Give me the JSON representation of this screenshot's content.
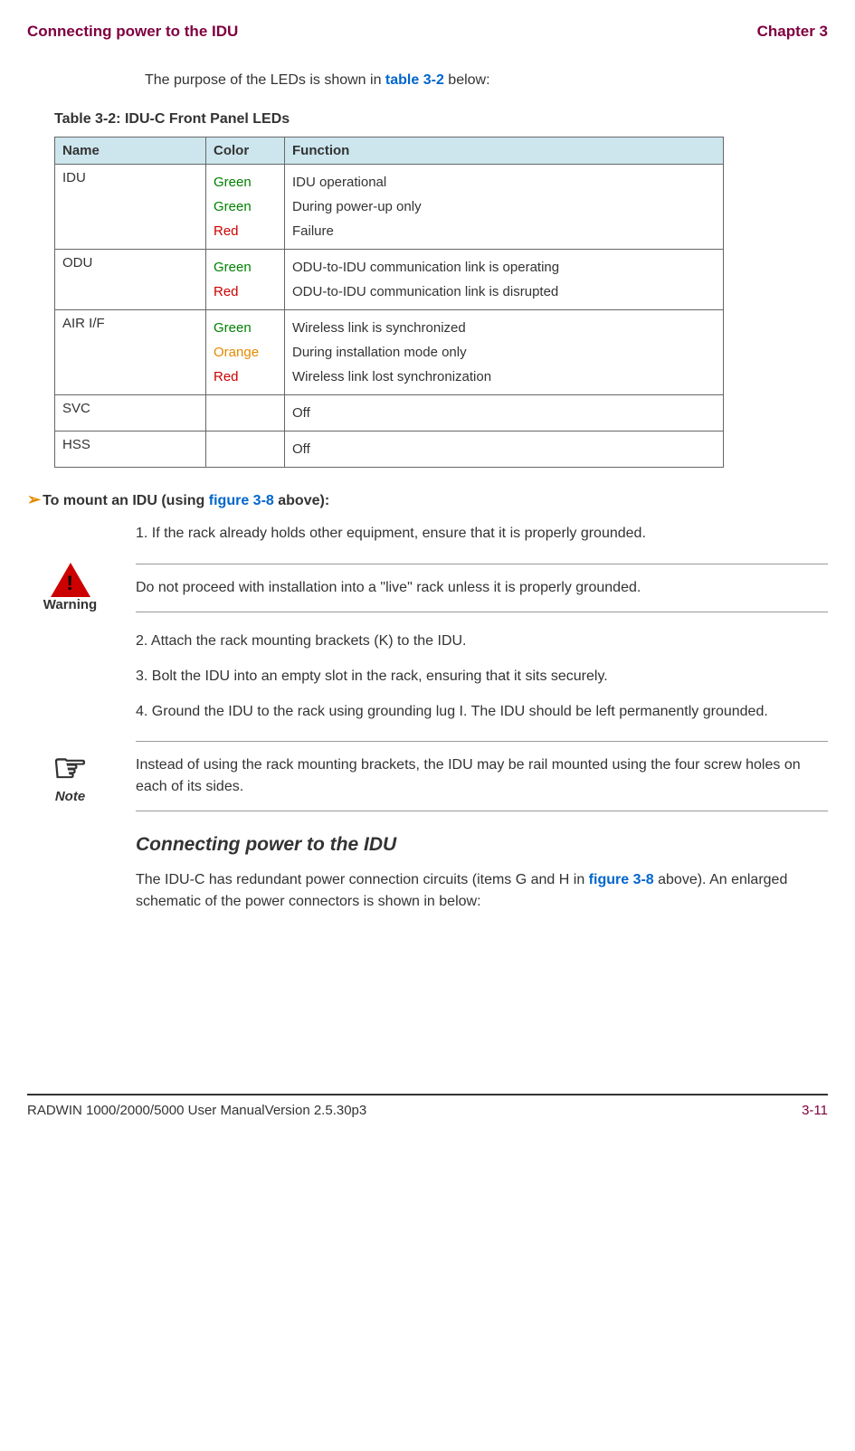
{
  "header": {
    "left": "Connecting power to the IDU",
    "right": "Chapter 3"
  },
  "intro": {
    "prefix": "The purpose of the LEDs is shown in ",
    "link": "table 3-2",
    "suffix": " below:"
  },
  "table": {
    "caption": "Table 3-2: IDU-C Front Panel LEDs",
    "headers": {
      "name": "Name",
      "color": "Color",
      "function": "Function"
    },
    "rows": [
      {
        "name": "IDU",
        "colors": [
          "Green",
          "Green",
          "Red"
        ],
        "colorClasses": [
          "green",
          "green",
          "red"
        ],
        "functions": [
          "IDU operational",
          "During power-up only",
          "Failure"
        ]
      },
      {
        "name": "ODU",
        "colors": [
          "Green",
          "Red"
        ],
        "colorClasses": [
          "green",
          "red"
        ],
        "functions": [
          "ODU-to-IDU communication link is operating",
          "ODU-to-IDU communication link is disrupted"
        ]
      },
      {
        "name": "AIR I/F",
        "colors": [
          "Green",
          "Orange",
          "Red"
        ],
        "colorClasses": [
          "green",
          "orange",
          "red"
        ],
        "functions": [
          "Wireless link is synchronized",
          "During installation mode only",
          "Wireless link lost synchronization"
        ]
      },
      {
        "name": "SVC",
        "colors": [
          ""
        ],
        "colorClasses": [
          ""
        ],
        "functions": [
          "Off"
        ]
      },
      {
        "name": "HSS",
        "colors": [
          ""
        ],
        "colorClasses": [
          ""
        ],
        "functions": [
          "Off"
        ]
      }
    ]
  },
  "mountHeading": {
    "prefix": "To mount an IDU (using ",
    "link": "figure 3-8",
    "suffix": " above):"
  },
  "steps": {
    "s1": "1. If the rack already holds other equipment, ensure that it is properly grounded.",
    "s2": "2. Attach the rack mounting brackets (K) to the IDU.",
    "s3": "3. Bolt the IDU into an empty slot in the rack, ensuring that it sits securely.",
    "s4": "4. Ground the IDU to the rack using grounding lug I. The IDU should be left permanently grounded."
  },
  "warning": {
    "label": "Warning",
    "text": "Do not proceed with installation into a \"live\" rack unless it is properly grounded."
  },
  "note": {
    "label": "Note",
    "text": "Instead of using the rack mounting brackets, the IDU may be rail mounted using the four screw holes on each of its sides."
  },
  "section": {
    "heading": "Connecting power to the IDU",
    "body1": "The IDU-C has redundant power connection circuits (items G and H in ",
    "link": "figure 3-8",
    "body2": " above). An enlarged schematic of the power connectors is shown in below:"
  },
  "footer": {
    "left": "RADWIN 1000/2000/5000 User ManualVersion  2.5.30p3",
    "right": "3-11"
  }
}
